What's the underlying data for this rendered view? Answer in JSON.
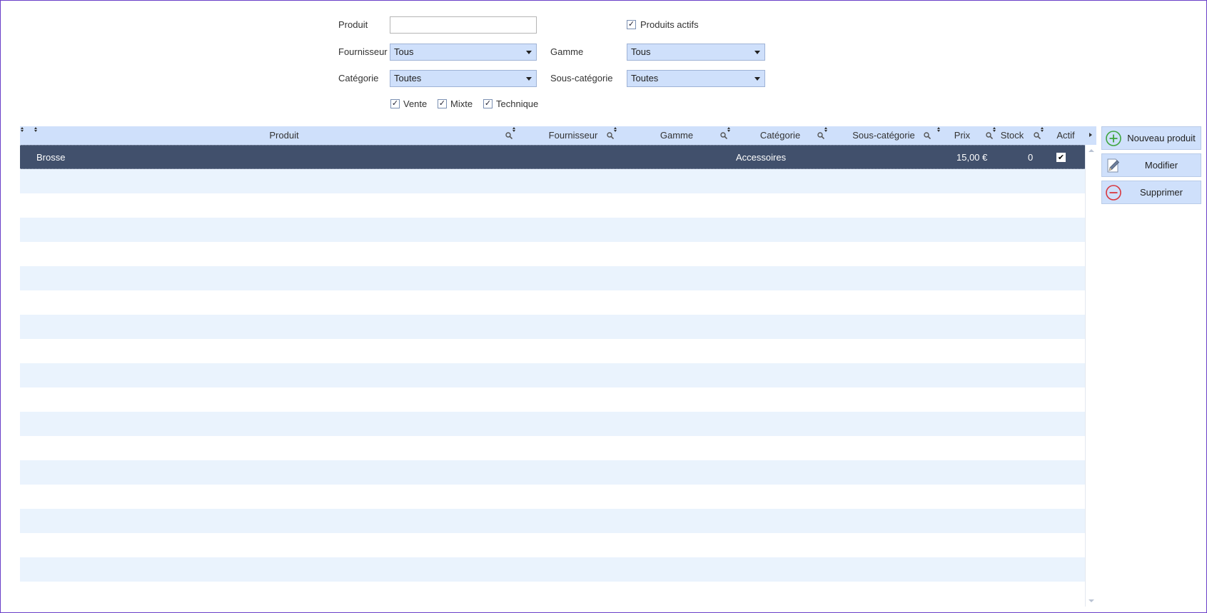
{
  "filters": {
    "produit_label": "Produit",
    "produit_value": "",
    "produits_actifs_label": "Produits actifs",
    "produits_actifs_checked": true,
    "fournisseur_label": "Fournisseur",
    "fournisseur_value": "Tous",
    "gamme_label": "Gamme",
    "gamme_value": "Tous",
    "categorie_label": "Catégorie",
    "categorie_value": "Toutes",
    "sous_categorie_label": "Sous-catégorie",
    "sous_categorie_value": "Toutes",
    "types": [
      {
        "label": "Vente",
        "checked": true
      },
      {
        "label": "Mixte",
        "checked": true
      },
      {
        "label": "Technique",
        "checked": true
      }
    ]
  },
  "grid": {
    "columns": {
      "produit": "Produit",
      "fournisseur": "Fournisseur",
      "gamme": "Gamme",
      "categorie": "Catégorie",
      "sous_categorie": "Sous-catégorie",
      "prix": "Prix",
      "stock": "Stock",
      "actif": "Actif"
    },
    "rows": [
      {
        "produit": "Brosse",
        "fournisseur": "",
        "gamme": "",
        "categorie": "Accessoires",
        "sous_categorie": "",
        "prix": "15,00 €",
        "stock": "0",
        "actif": true
      }
    ]
  },
  "actions": {
    "nouveau": "Nouveau produit",
    "modifier": "Modifier",
    "supprimer": "Supprimer"
  },
  "colors": {
    "header_bg": "#cfe0fb",
    "selected_row_bg": "#41506c",
    "alt_row_bg": "#eaf3fd",
    "add_icon": "#3fa63f",
    "remove_icon": "#d9363e"
  },
  "icons": {
    "nouveau": "plus-circle-icon",
    "modifier": "pencil-icon",
    "supprimer": "minus-circle-icon",
    "filter": "magnifier-icon",
    "sort": "sort-arrows-icon"
  }
}
